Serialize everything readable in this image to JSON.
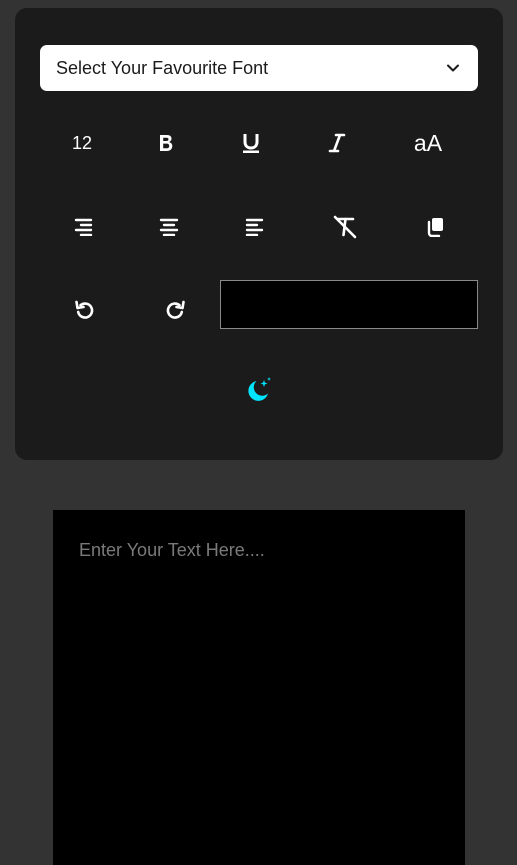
{
  "toolbar": {
    "font_select": {
      "selected_label": "Select Your Favourite Font",
      "icon": "chevron-down-icon"
    },
    "row1": [
      {
        "name": "font-size-button",
        "label": "12",
        "icon": "font-size"
      },
      {
        "name": "bold-button",
        "icon": "bold-icon"
      },
      {
        "name": "underline-button",
        "icon": "underline-icon"
      },
      {
        "name": "italic-button",
        "icon": "italic-icon"
      },
      {
        "name": "change-case-button",
        "label": "aA",
        "icon": "case-icon"
      }
    ],
    "row2": [
      {
        "name": "align-right-button",
        "icon": "align-right-icon"
      },
      {
        "name": "align-center-button",
        "icon": "align-center-icon"
      },
      {
        "name": "align-left-button",
        "icon": "align-left-icon"
      },
      {
        "name": "clear-format-button",
        "icon": "clear-format-icon"
      },
      {
        "name": "copy-button",
        "icon": "copy-icon"
      }
    ],
    "row3": [
      {
        "name": "undo-button",
        "icon": "undo-icon"
      },
      {
        "name": "redo-button",
        "icon": "redo-icon"
      }
    ],
    "color_picker": {
      "value": "#000000"
    },
    "theme_toggle": {
      "icon": "moon-stars-icon",
      "color": "#00e5ff"
    }
  },
  "editor": {
    "placeholder": "Enter Your Text Here....",
    "value": ""
  },
  "colors": {
    "page_bg": "#333333",
    "panel_bg": "#1b1b1b",
    "editor_bg": "#000000",
    "accent": "#00e5ff",
    "icon": "#ffffff"
  }
}
